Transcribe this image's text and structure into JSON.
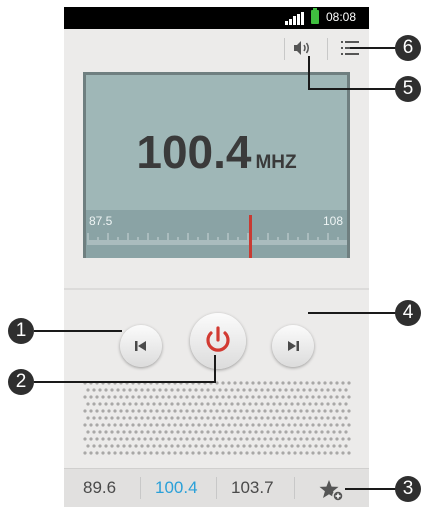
{
  "status_bar": {
    "time": "08:08"
  },
  "radio": {
    "frequency": "100.4",
    "unit": "MHZ",
    "range_min": "87.5",
    "range_max": "108",
    "tuned_value": 100.4
  },
  "favorites": [
    "89.6",
    "100.4",
    "103.7"
  ],
  "active_favorite_index": 1,
  "callouts": [
    "1",
    "2",
    "3",
    "4",
    "5",
    "6"
  ],
  "icons": {
    "volume": "volume-icon",
    "menu": "list-menu-icon",
    "prev": "previous-station-icon",
    "power": "power-icon",
    "next": "next-station-icon",
    "add_favorite": "star-add-icon"
  },
  "colors": {
    "accent": "#2aa0d8",
    "power": "#d23a32",
    "needle": "#c83a32",
    "display": "#9fb7b7"
  }
}
